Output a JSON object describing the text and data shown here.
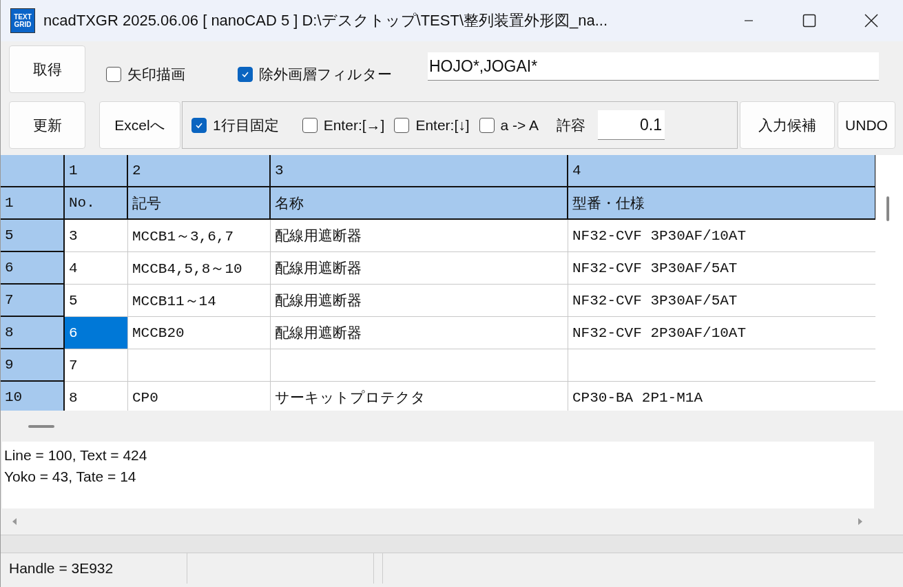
{
  "window": {
    "title": "ncadTXGR 2025.06.06 [ nanoCAD 5 ] D:\\デスクトップ\\TEST\\整列装置外形図_na...",
    "app_icon": [
      "TEXT",
      "GRID"
    ]
  },
  "toolbar": {
    "get_button": "取得",
    "update_button": "更新",
    "excel_button": "Excelへ",
    "suggest_button": "入力候補",
    "undo_button": "UNDO",
    "arrow_checkbox": {
      "label": "矢印描画",
      "checked": false
    },
    "filter_checkbox": {
      "label": "除外画層フィルター",
      "checked": true
    },
    "filter_field": {
      "value": "HOJO*,JOGAI*"
    },
    "options": [
      {
        "label": "1行目固定",
        "checked": true
      },
      {
        "label": "Enter:[→]",
        "checked": false
      },
      {
        "label": "Enter:[↓]",
        "checked": false
      },
      {
        "label": "a -> A",
        "checked": false
      }
    ],
    "tolerance": {
      "label": "許容",
      "value": "0.1"
    }
  },
  "grid": {
    "column_headers": [
      "1",
      "2",
      "3",
      "4"
    ],
    "rows": [
      {
        "header": "1",
        "kind": "header",
        "cells": [
          {
            "text": "No.",
            "selected": false
          },
          {
            "text": "記号",
            "selected": false
          },
          {
            "text": "名称",
            "selected": false
          },
          {
            "text": "型番・仕様",
            "selected": false
          }
        ]
      },
      {
        "header": "5",
        "kind": "data",
        "cells": [
          {
            "text": "3",
            "selected": false
          },
          {
            "text": "MCCB1～3,6,7",
            "selected": false
          },
          {
            "text": "配線用遮断器",
            "selected": false
          },
          {
            "text": "NF32-CVF 3P30AF/10AT",
            "selected": false
          }
        ]
      },
      {
        "header": "6",
        "kind": "data",
        "cells": [
          {
            "text": "4",
            "selected": false
          },
          {
            "text": "MCCB4,5,8～10",
            "selected": false
          },
          {
            "text": "配線用遮断器",
            "selected": false
          },
          {
            "text": "NF32-CVF 3P30AF/5AT",
            "selected": false
          }
        ]
      },
      {
        "header": "7",
        "kind": "data",
        "cells": [
          {
            "text": "5",
            "selected": false
          },
          {
            "text": "MCCB11～14",
            "selected": false
          },
          {
            "text": "配線用遮断器",
            "selected": false
          },
          {
            "text": "NF32-CVF 3P30AF/5AT",
            "selected": false
          }
        ]
      },
      {
        "header": "8",
        "kind": "data",
        "cells": [
          {
            "text": "6",
            "selected": true
          },
          {
            "text": "MCCB20",
            "selected": false
          },
          {
            "text": "配線用遮断器",
            "selected": false
          },
          {
            "text": "NF32-CVF 2P30AF/10AT",
            "selected": false
          }
        ]
      },
      {
        "header": "9",
        "kind": "data",
        "cells": [
          {
            "text": "7",
            "selected": false
          },
          {
            "selected": false
          },
          {
            "selected": false
          },
          {
            "selected": false
          }
        ]
      },
      {
        "header": "10",
        "kind": "data",
        "cells": [
          {
            "text": "8",
            "selected": false
          },
          {
            "text": "CP0",
            "selected": false
          },
          {
            "text": "サーキットプロテクタ",
            "selected": false
          },
          {
            "text": "CP30-BA 2P1-M1A",
            "selected": false
          }
        ]
      }
    ]
  },
  "log": [
    "Line = 100, Text = 424",
    "Yoko = 43, Tate = 14"
  ],
  "status_bar": {
    "handle": "Handle = 3E932"
  }
}
